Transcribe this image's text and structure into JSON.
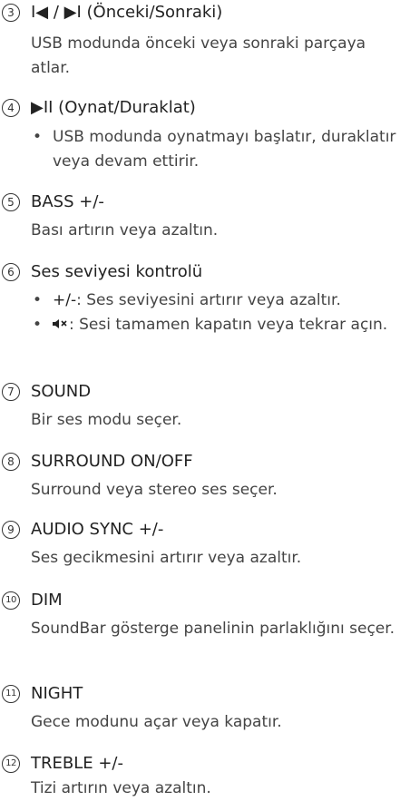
{
  "items": [
    {
      "number": "3",
      "title": "I◀ / ▶I (Önceki/Sonraki)",
      "description": "USB modunda önceki veya sonraki parçaya atlar."
    },
    {
      "number": "4",
      "title": "▶II (Oynat/Duraklat)",
      "bullets": [
        "USB modunda oynatmayı başlatır, duraklatır veya devam ettirir."
      ]
    },
    {
      "number": "5",
      "title": "BASS +/-",
      "description": "Bası artırın veya azaltın."
    },
    {
      "number": "6",
      "title": "Ses seviyesi kontrolü",
      "bullets": [
        {
          "prefix": "+/-",
          "text": ": Ses seviyesini artırır veya azaltır."
        },
        {
          "icon": "mute-icon",
          "text": ": Sesi tamamen kapatın veya tekrar açın."
        }
      ]
    },
    {
      "number": "7",
      "title": "SOUND",
      "description": "Bir ses modu seçer."
    },
    {
      "number": "8",
      "title": "SURROUND ON/OFF",
      "description": "Surround veya stereo ses seçer."
    },
    {
      "number": "9",
      "title": "AUDIO SYNC +/-",
      "description": "Ses gecikmesini artırır veya azaltır."
    },
    {
      "number": "10",
      "title": "DIM",
      "description": "SoundBar gösterge panelinin parlaklığını seçer."
    },
    {
      "number": "11",
      "title": "NIGHT",
      "description": "Gece modunu açar veya kapatır."
    },
    {
      "number": "12",
      "title": "TREBLE +/-",
      "description": "Tizi artırın veya azaltın."
    }
  ],
  "bullet_symbol": "•"
}
